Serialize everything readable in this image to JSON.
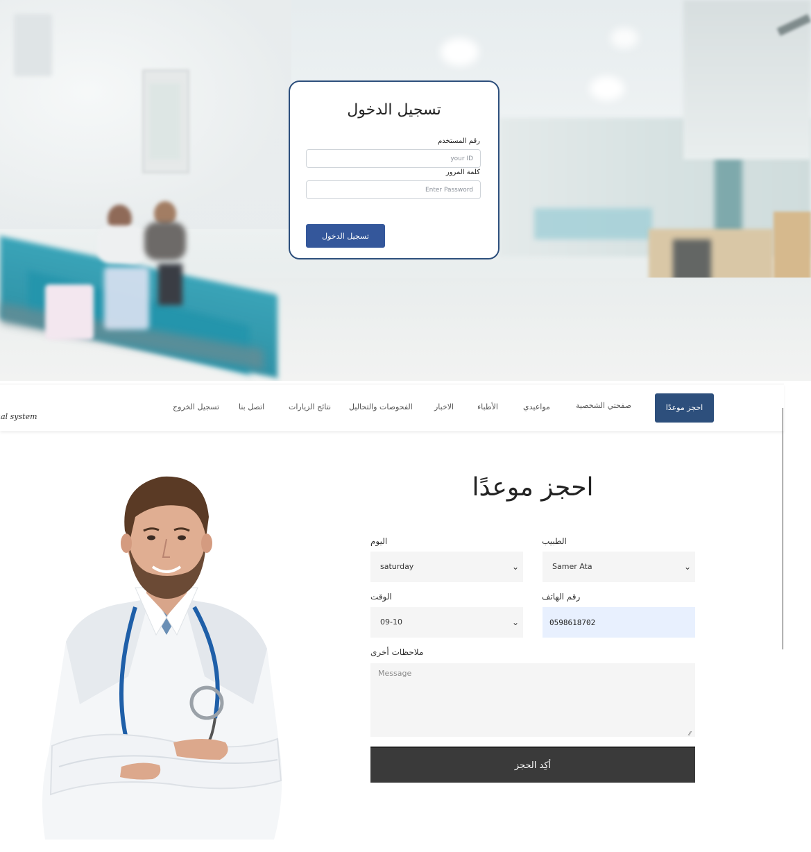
{
  "login": {
    "title": "تسجيل الدخول",
    "user_id_label": "رقم المستخدم",
    "user_id_placeholder": "your ID",
    "password_label": "كلمة المرور",
    "password_placeholder": "Enter Password",
    "submit_label": "تسجيل الدخول"
  },
  "navbar": {
    "brand": "nal system",
    "items": [
      {
        "label": "احجز موعدًا"
      },
      {
        "label": "صفحتي الشخصية"
      },
      {
        "label": "مواعيدي"
      },
      {
        "label": "الأطباء"
      },
      {
        "label": "الاخبار"
      },
      {
        "label": "الفحوصات والتحاليل"
      },
      {
        "label": "نتائج الزيارات"
      },
      {
        "label": "اتصل بنا"
      },
      {
        "label": "تسجيل الخروج"
      }
    ]
  },
  "booking": {
    "title": "احجز موعدًا",
    "doctor_label": "الطبيب",
    "doctor_value": "Samer Ata",
    "day_label": "اليوم",
    "day_value": "saturday",
    "phone_label": "رقم الهاتف",
    "phone_value": "0598618702",
    "time_label": "الوقت",
    "time_value": "09-10",
    "notes_label": "ملاحظات أخرى",
    "notes_placeholder": "Message",
    "confirm_label": "أكِد الحجز"
  },
  "colors": {
    "primary": "#2d4f7c",
    "login_button": "#34579b",
    "confirm_button": "#3a3a3a",
    "phone_autofill": "#e8f0fe"
  },
  "icons": {
    "select_chevron": "chevron-down-icon",
    "textarea_resize": "resize-handle-icon"
  }
}
